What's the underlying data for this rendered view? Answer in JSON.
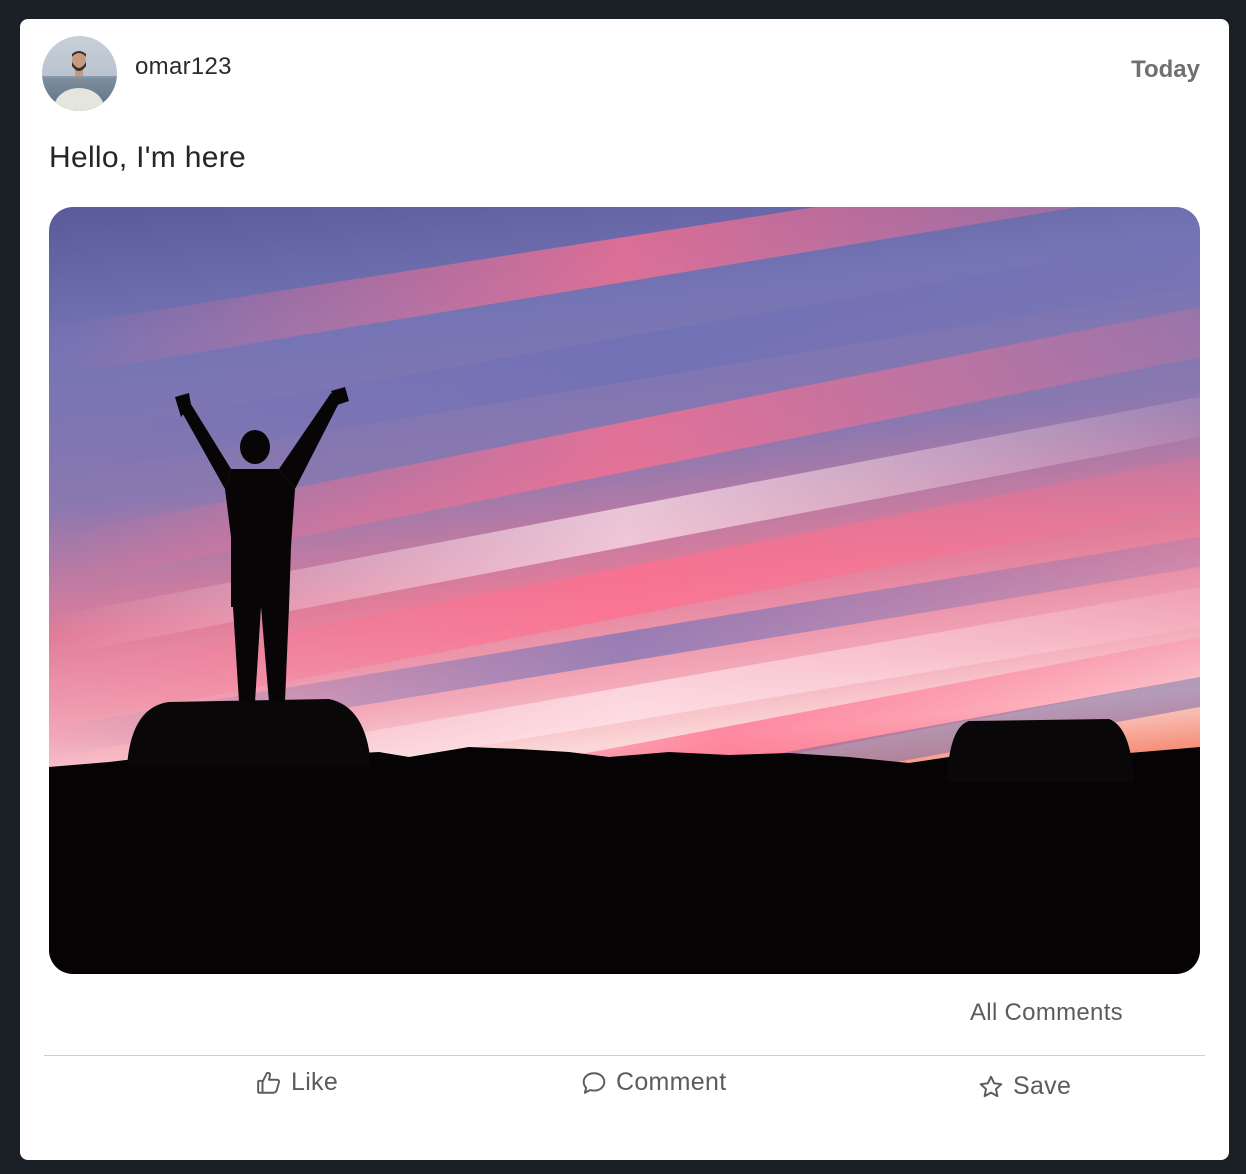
{
  "post": {
    "username": "omar123",
    "date": "Today",
    "text": "Hello, I'm here",
    "all_comments_label": "All Comments"
  },
  "actions": {
    "like_label": "Like",
    "comment_label": "Comment",
    "save_label": "Save"
  },
  "icons": {
    "like": "thumbs-up-icon",
    "comment": "speech-bubble-icon",
    "save": "star-icon"
  },
  "colors": {
    "page_background": "#1b1f26",
    "card_background": "#ffffff",
    "muted_text": "#5c5c5c",
    "date_text": "#707070"
  }
}
